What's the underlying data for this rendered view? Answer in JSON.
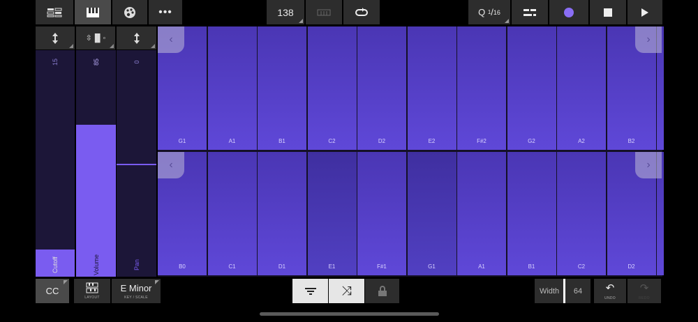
{
  "topbar": {
    "tempo": "138",
    "quantize": {
      "prefix": "Q",
      "num": "1",
      "den": "16"
    },
    "record_color": "#8a6ef5"
  },
  "cc": {
    "toggle_label": "CC",
    "columns": [
      {
        "name": "Cutoff",
        "value": "15",
        "level": 0.12
      },
      {
        "name": "Volume",
        "value": "85",
        "level": 0.67
      },
      {
        "name": "Pan",
        "value": "0",
        "level": 0.5
      }
    ]
  },
  "pads": {
    "top_row": [
      "G1",
      "A1",
      "B1",
      "C2",
      "D2",
      "E2",
      "F#2",
      "G2",
      "A2",
      "B2"
    ],
    "bottom_row": [
      "B0",
      "C1",
      "D1",
      "E1",
      "F#1",
      "G1",
      "A1",
      "B1",
      "C2",
      "D2"
    ]
  },
  "bottom": {
    "layout_label": "LAYOUT",
    "key_value": "E Minor",
    "key_label": "KEY / SCALE",
    "width_label": "Width",
    "width_value": "64",
    "undo_label": "UNDO",
    "redo_label": "REDO"
  },
  "colors": {
    "accent": "#7a5cf0",
    "pad": "#5540c8"
  }
}
